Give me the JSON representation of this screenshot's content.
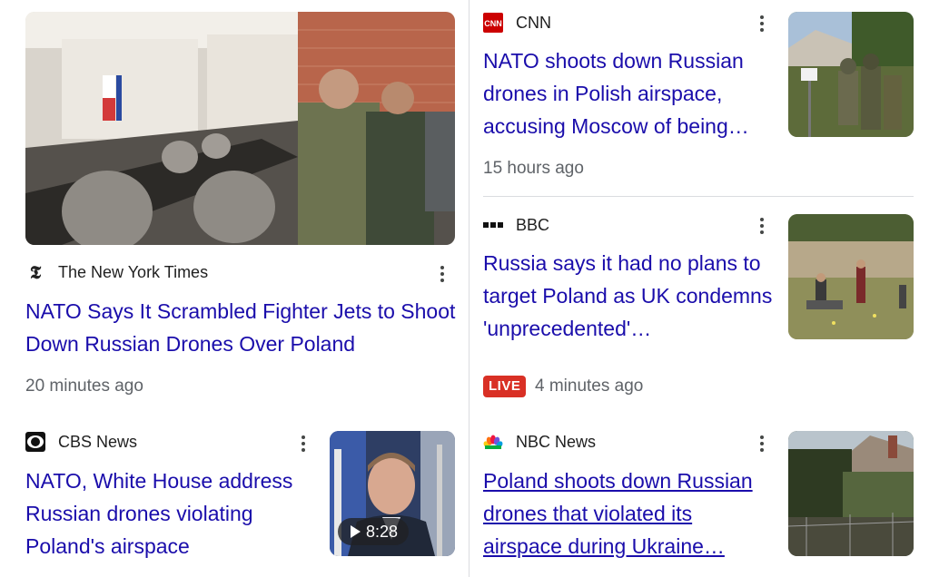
{
  "colors": {
    "link": "#1a0dab",
    "meta": "#5f6368",
    "live": "#d93025",
    "divider": "#dadce0"
  },
  "stories": [
    {
      "source": "The New York Times",
      "source_icon": "nyt-logo-icon",
      "headline": "NATO Says It Scrambled Fighter Jets to Shoot Down Russian Drones Over Poland",
      "time": "20 minutes ago",
      "thumbnail": "military-officials-meeting-room-image"
    },
    {
      "source": "CNN",
      "source_icon": "cnn-logo-icon",
      "headline": "NATO shoots down Russian drones in Polish airspace, accusing Moscow of being…",
      "time": "15 hours ago",
      "thumbnail": "soldiers-in-forest-image"
    },
    {
      "source": "BBC",
      "source_icon": "bbc-logo-icon",
      "headline": "Russia says it had no plans to target Poland as UK condemns 'unprecedented'…",
      "live_label": "LIVE",
      "time": "4 minutes ago",
      "thumbnail": "investigators-in-field-image"
    },
    {
      "source": "CBS News",
      "source_icon": "cbs-eye-logo-icon",
      "headline": "NATO, White House address Russian drones violating Poland's airspace",
      "video_duration": "8:28",
      "thumbnail": "nato-official-speaking-video"
    },
    {
      "source": "NBC News",
      "source_icon": "nbc-peacock-logo-icon",
      "headline": "Poland shoots down Russian drones that violated its airspace during Ukraine…",
      "thumbnail": "damaged-house-roof-image"
    }
  ]
}
